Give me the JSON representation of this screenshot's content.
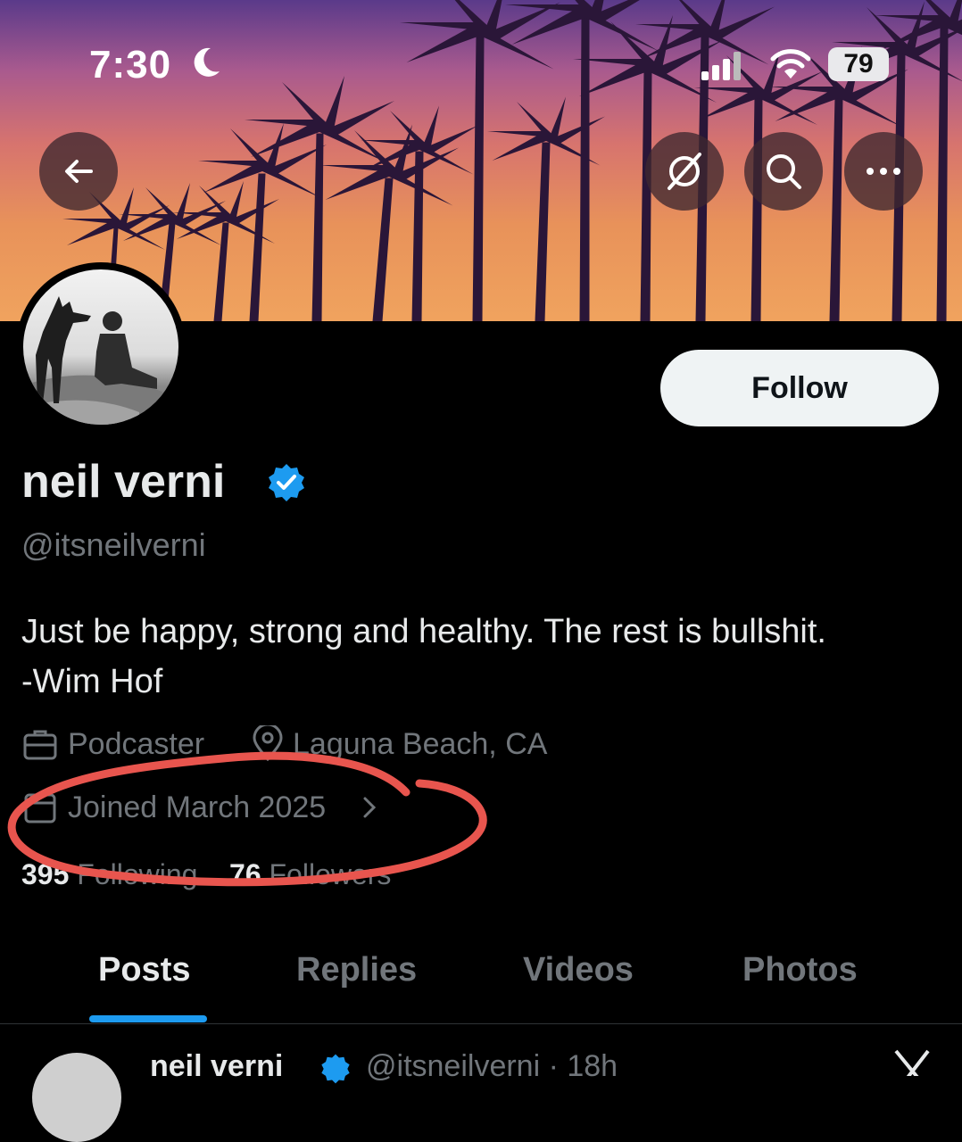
{
  "status": {
    "time": "7:30",
    "battery": "79"
  },
  "profile": {
    "name": "neil verni",
    "handle": "@itsneilverni",
    "bio_line1": "Just be happy, strong and healthy. The rest is bullshit.",
    "bio_line2": "-Wim Hof",
    "profession": "Podcaster",
    "location": "Laguna Beach, CA",
    "joined": "Joined March 2025",
    "following_count": "395",
    "following_label": "Following",
    "followers_count": "76",
    "followers_label": "Followers",
    "follow_label": "Follow"
  },
  "tabs": [
    "Posts",
    "Replies",
    "Videos",
    "Photos"
  ],
  "active_tab": "Posts",
  "next_post": {
    "name": "neil verni",
    "handle": "@itsneilverni · 18h"
  },
  "colors": {
    "accent": "#1d9bf0",
    "annotation": "#e8554e",
    "background": "#000000"
  },
  "icons": [
    "back-arrow-icon",
    "grok-icon",
    "search-icon",
    "more-icon",
    "verified-badge-icon",
    "briefcase-icon",
    "location-pin-icon",
    "calendar-icon",
    "chevron-right-icon",
    "x-logo-icon"
  ]
}
